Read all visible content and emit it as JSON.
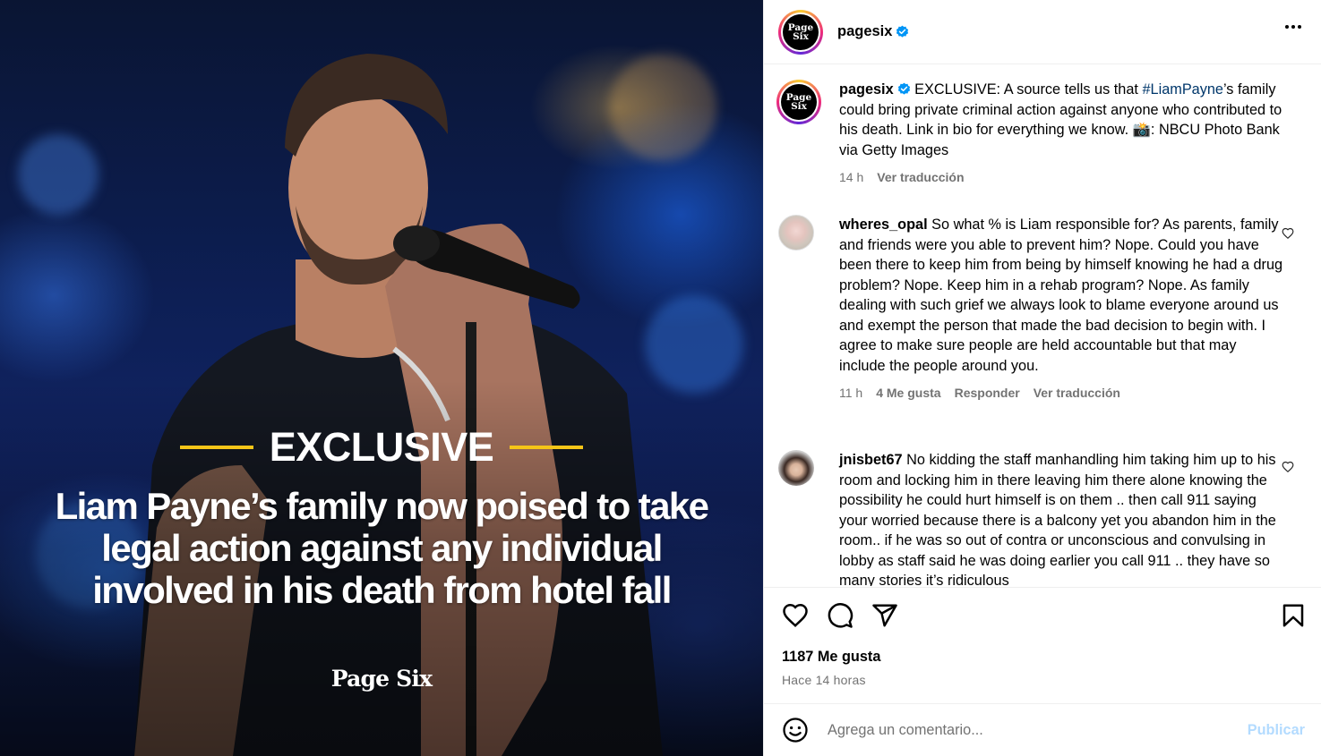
{
  "post_image": {
    "kicker": "EXCLUSIVE",
    "headline": "Liam Payne’s family now poised to take legal action against any individual involved in his death from hotel fall",
    "brand": "Page Six",
    "accent_color": "#f5c518"
  },
  "header": {
    "avatar_text_line1": "Page",
    "avatar_text_line2": "Six",
    "username": "pagesix",
    "verified_icon": "verified-badge-icon",
    "more_icon": "more-options-icon"
  },
  "caption": {
    "username": "pagesix",
    "text_before_tag": " EXCLUSIVE: A source tells us that ",
    "hashtag": "#LiamPayne",
    "text_after_tag": "’s family could bring private criminal action against anyone who contributed to his death. Link in bio for everything we know. 📸: NBCU Photo Bank via Getty Images",
    "time": "14 h",
    "translate": "Ver traducción"
  },
  "comments": [
    {
      "username": "wheres_opal",
      "text": " So what % is Liam responsible for? As parents, family and friends were you able to prevent him? Nope. Could you have been there to keep him from being by himself knowing he had a drug problem? Nope. Keep him in a rehab program? Nope. As family dealing with such grief we always look to blame everyone around us and exempt the person that made the bad decision to begin with. I agree to make sure people are held accountable but that may include the people around you.",
      "time": "11 h",
      "likes": "4 Me gusta",
      "reply": "Responder",
      "translate": "Ver traducción"
    },
    {
      "username": "jnisbet67",
      "text": " No kidding the staff manhandling him taking him up to his room and locking him in there leaving him there alone knowing the possibility he could hurt himself is on them .. then call 911 saying your worried because there is a balcony yet you abandon him in the room.. if he was so out of contra or unconscious and convulsing in lobby as staff said he was doing earlier you call 911 .. they have so many stories it’s ridiculous"
    }
  ],
  "actions": {
    "icons": [
      "heart-icon",
      "comment-icon",
      "share-icon",
      "bookmark-icon"
    ],
    "likes": "1187 Me gusta",
    "time_ago": "Hace 14 horas"
  },
  "add_comment": {
    "emoji_icon": "emoji-icon",
    "placeholder": "Agrega un comentario...",
    "publish": "Publicar"
  },
  "colors": {
    "link": "#00376b",
    "secondary_text": "#737373",
    "publish_disabled": "#b3dbff",
    "verified": "#0095f6"
  }
}
